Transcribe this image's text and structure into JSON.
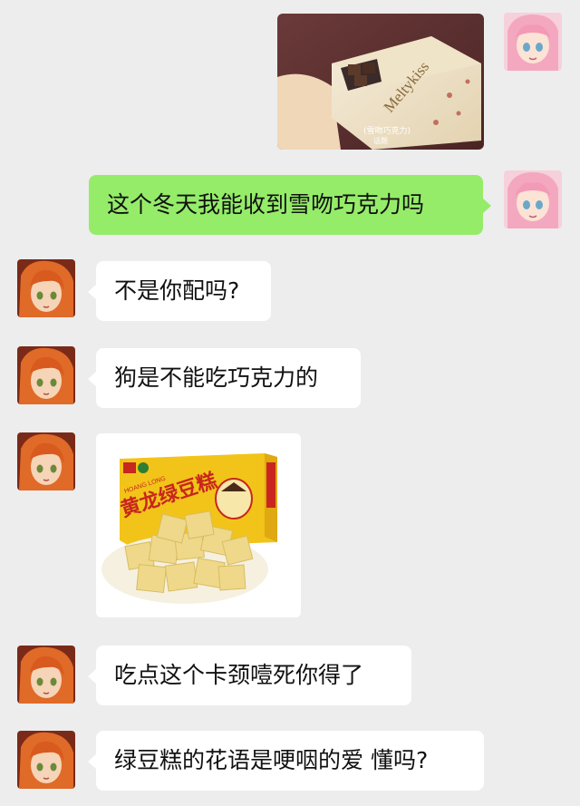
{
  "chat": {
    "messages": [
      {
        "side": "right",
        "type": "image",
        "image_name": "meltykiss-chocolate-photo",
        "box_brand": "Meltykiss",
        "caption": "(雪吻巧克力)",
        "caption2": "话题"
      },
      {
        "side": "right",
        "type": "text",
        "text": "这个冬天我能收到雪吻巧克力吗"
      },
      {
        "side": "left",
        "type": "text",
        "text": "不是你配吗?"
      },
      {
        "side": "left",
        "type": "text",
        "text": "狗是不能吃巧克力的"
      },
      {
        "side": "left",
        "type": "image",
        "image_name": "mung-bean-cake-photo",
        "box_title": "黄龙绿豆糕",
        "box_brand": "HOANG LONG"
      },
      {
        "side": "left",
        "type": "text",
        "text": "吃点这个卡颈噎死你得了"
      },
      {
        "side": "left",
        "type": "text",
        "text": "绿豆糕的花语是哽咽的爱 懂吗?"
      }
    ]
  },
  "colors": {
    "background": "#ededed",
    "sent_bubble": "#95ec69",
    "received_bubble": "#ffffff"
  }
}
